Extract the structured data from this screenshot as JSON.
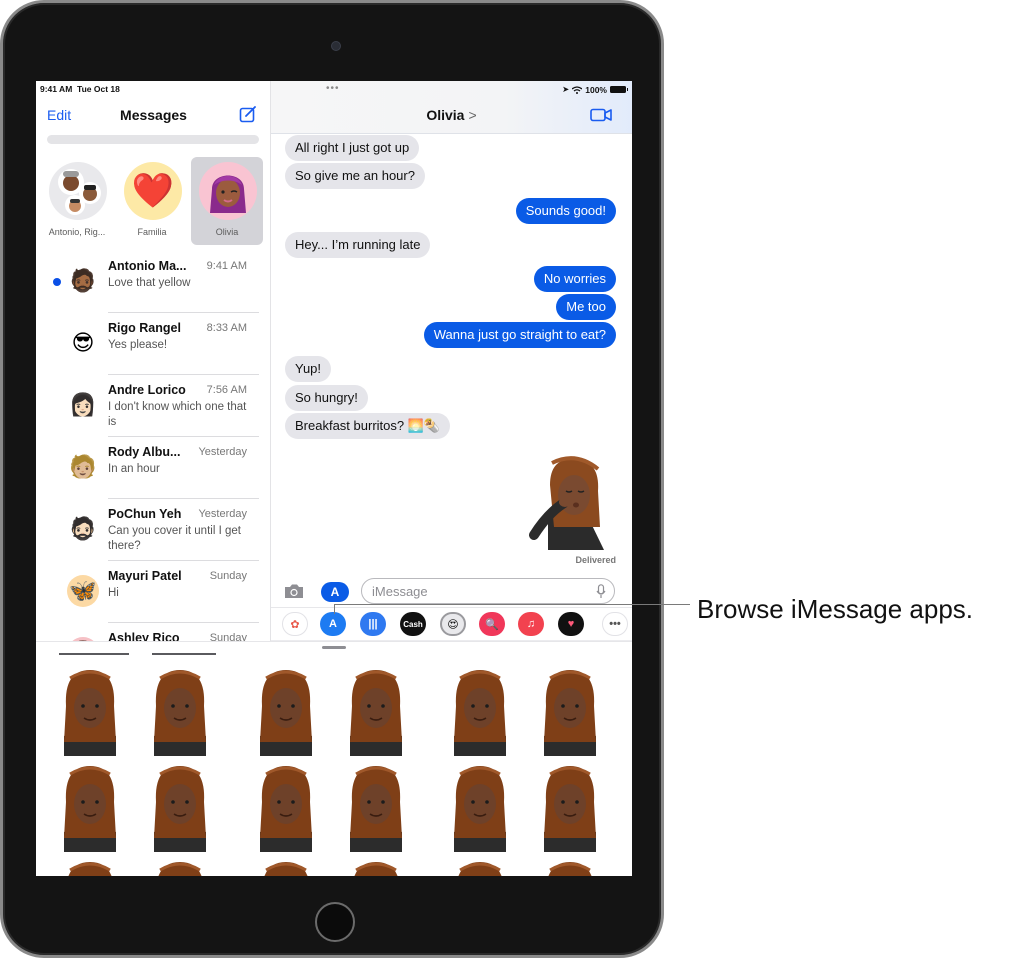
{
  "status_bar": {
    "time": "9:41 AM",
    "date": "Tue Oct 18",
    "multitask_dots": "•••",
    "battery_percent": "100%"
  },
  "sidebar": {
    "edit_label": "Edit",
    "title": "Messages",
    "compose_icon": "compose-icon",
    "pinned": [
      {
        "label": "Antonio, Rig...",
        "avatar": "group-memoji",
        "selected": false
      },
      {
        "label": "Familia",
        "avatar": "❤️",
        "selected": false
      },
      {
        "label": "Olivia",
        "avatar": "👩🏾‍🦰",
        "selected": true
      }
    ],
    "conversations": [
      {
        "name": "Antonio Ma...",
        "time": "9:41 AM",
        "preview": "Love that yellow",
        "unread": true,
        "avatar": "🧔🏾"
      },
      {
        "name": "Rigo Rangel",
        "time": "8:33 AM",
        "preview": "Yes please!",
        "unread": false,
        "avatar": "😎"
      },
      {
        "name": "Andre Lorico",
        "time": "7:56 AM",
        "preview": "I don't know which one that is",
        "unread": false,
        "avatar": "👩🏻"
      },
      {
        "name": "Rody Albu...",
        "time": "Yesterday",
        "preview": "In an hour",
        "unread": false,
        "avatar": "🧑🏼"
      },
      {
        "name": "PoChun Yeh",
        "time": "Yesterday",
        "preview": "Can you cover it until I get there?",
        "unread": false,
        "avatar": "🧔🏻"
      },
      {
        "name": "Mayuri Patel",
        "time": "Sunday",
        "preview": "Hi",
        "unread": false,
        "avatar": "🦋"
      },
      {
        "name": "Ashley Rico",
        "time": "Sunday",
        "preview": "",
        "unread": false,
        "avatar": "👩"
      }
    ]
  },
  "chat": {
    "contact_name": "Olivia",
    "chevron": ">",
    "messages": [
      {
        "from": "them",
        "text": "All right I just got up"
      },
      {
        "from": "them",
        "text": "So give me an hour?"
      },
      {
        "from": "me",
        "text": "Sounds good!"
      },
      {
        "from": "them",
        "text": "Hey... I’m running late"
      },
      {
        "from": "me",
        "text": "No worries"
      },
      {
        "from": "me",
        "text": "Me too"
      },
      {
        "from": "me",
        "text": "Wanna just go straight to eat?"
      },
      {
        "from": "them",
        "text": "Yup!"
      },
      {
        "from": "them",
        "text": "So hungry!"
      },
      {
        "from": "them",
        "text": "Breakfast burritos? 🌅🌯"
      }
    ],
    "sticker_status": "Delivered",
    "input_placeholder": "iMessage",
    "input_value": ""
  },
  "app_strip": {
    "apps": [
      {
        "name": "photos-app",
        "glyph": "✿",
        "bg": "#ffffff",
        "fg": "#e8594a"
      },
      {
        "name": "app-store-app",
        "glyph": "A",
        "bg": "#1d7bf2",
        "fg": "#ffffff"
      },
      {
        "name": "audio-message-app",
        "glyph": "|||",
        "bg": "#2f79f0",
        "fg": "#ffffff"
      },
      {
        "name": "apple-cash-app",
        "glyph": "Cash",
        "bg": "#111111",
        "fg": "#ffffff"
      },
      {
        "name": "memoji-stickers-app",
        "glyph": "😍",
        "bg": "#e9e9ec",
        "fg": "#111111"
      },
      {
        "name": "images-search-app",
        "glyph": "🔍",
        "bg": "#f0375a",
        "fg": "#ffffff"
      },
      {
        "name": "music-app",
        "glyph": "♫",
        "bg": "#f2424f",
        "fg": "#ffffff"
      },
      {
        "name": "digital-touch-app",
        "glyph": "♥",
        "bg": "#111111",
        "fg": "#ff5a7a"
      },
      {
        "name": "more-apps",
        "glyph": "•••",
        "bg": "#ffffff",
        "fg": "#555555"
      }
    ]
  },
  "drawer": {
    "stickers": [
      "hand-on-cheek",
      "meditating",
      "hand-to-mouth",
      "thumbs-up",
      "thumbs-down",
      "peace-sign",
      "jazz-hands",
      "fist-bump",
      "covering-mouth",
      "shrug-palm",
      "praying-hands",
      "crossed-arms"
    ]
  },
  "callout": {
    "text": "Browse iMessage apps."
  },
  "colors": {
    "accent": "#0a5be6",
    "incoming_bubble": "#e5e5ea",
    "link_blue": "#1a5cf0"
  }
}
